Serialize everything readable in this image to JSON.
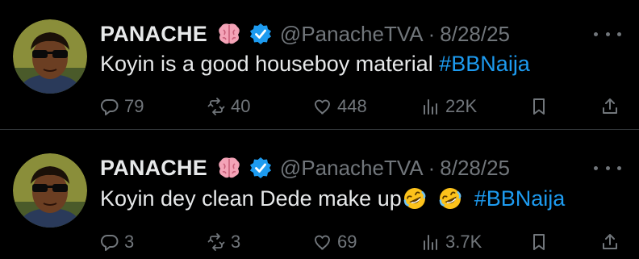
{
  "tweets": [
    {
      "name": "PANACHE",
      "handle": "@PanacheTVA",
      "separator": "·",
      "date": "8/28/25",
      "text": "Koyin is a good houseboy material ",
      "hashtag": "#BBNaija",
      "stats": {
        "replies": "79",
        "reposts": "40",
        "likes": "448",
        "views": "22K"
      }
    },
    {
      "name": "PANACHE",
      "handle": "@PanacheTVA",
      "separator": "·",
      "date": "8/28/25",
      "text": "Koyin dey clean Dede make up",
      "hashtag": "#BBNaija",
      "stats": {
        "replies": "3",
        "reposts": "3",
        "likes": "69",
        "views": "3.7K"
      }
    }
  ],
  "colors": {
    "background": "#000000",
    "text": "#e7e9ea",
    "muted": "#71767b",
    "accent": "#1d9bf0",
    "divider": "#2f3336"
  },
  "icons": [
    "brain-emoji",
    "verified-badge-icon",
    "more-icon",
    "reply-icon",
    "repost-icon",
    "like-icon",
    "views-icon",
    "bookmark-icon",
    "share-icon",
    "rolling-laughing-emoji"
  ]
}
